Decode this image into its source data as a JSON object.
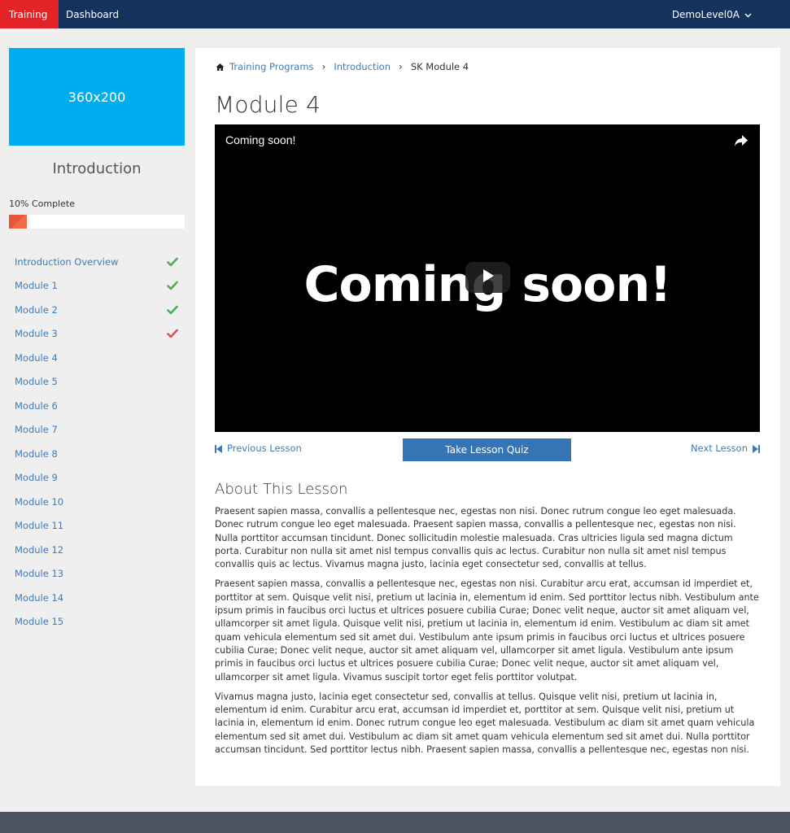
{
  "nav": {
    "tabs": [
      {
        "label": "Training",
        "active": true
      },
      {
        "label": "Dashboard",
        "active": false
      }
    ],
    "user": "DemoLevel0A"
  },
  "sidebar": {
    "thumbnail_text": "360x200",
    "course_title": "Introduction",
    "progress_label": "10% Complete",
    "progress_percent": 10,
    "modules": [
      {
        "label": "Introduction Overview",
        "status": "complete"
      },
      {
        "label": "Module 1",
        "status": "complete"
      },
      {
        "label": "Module 2",
        "status": "complete"
      },
      {
        "label": "Module 3",
        "status": "failed"
      },
      {
        "label": "Module 4",
        "status": "none"
      },
      {
        "label": "Module 5",
        "status": "none"
      },
      {
        "label": "Module 6",
        "status": "none"
      },
      {
        "label": "Module 7",
        "status": "none"
      },
      {
        "label": "Module 8",
        "status": "none"
      },
      {
        "label": "Module 9",
        "status": "none"
      },
      {
        "label": "Module 10",
        "status": "none"
      },
      {
        "label": "Module 11",
        "status": "none"
      },
      {
        "label": "Module 12",
        "status": "none"
      },
      {
        "label": "Module 13",
        "status": "none"
      },
      {
        "label": "Module 14",
        "status": "none"
      },
      {
        "label": "Module 15",
        "status": "none"
      }
    ]
  },
  "breadcrumb": {
    "items": [
      "Training Programs",
      "Introduction"
    ],
    "current": "SK Module 4"
  },
  "main": {
    "title": "Module 4",
    "video": {
      "title": "Coming soon!",
      "overlay_text": "Coming soon!"
    },
    "prev_label": "Previous Lesson",
    "quiz_label": "Take Lesson Quiz",
    "next_label": "Next Lesson",
    "about_heading": "About This Lesson",
    "about_paragraphs": [
      "Praesent sapien massa, convallis a pellentesque nec, egestas non nisi. Donec rutrum congue leo eget malesuada. Donec rutrum congue leo eget malesuada. Praesent sapien massa, convallis a pellentesque nec, egestas non nisi. Nulla porttitor accumsan tincidunt. Donec sollicitudin molestie malesuada. Cras ultricies ligula sed magna dictum porta. Curabitur non nulla sit amet nisl tempus convallis quis ac lectus. Curabitur non nulla sit amet nisl tempus convallis quis ac lectus. Vivamus magna justo, lacinia eget consectetur sed, convallis at tellus.",
      "Praesent sapien massa, convallis a pellentesque nec, egestas non nisi. Curabitur arcu erat, accumsan id imperdiet et, porttitor at sem. Quisque velit nisi, pretium ut lacinia in, elementum id enim. Sed porttitor lectus nibh. Vestibulum ante ipsum primis in faucibus orci luctus et ultrices posuere cubilia Curae; Donec velit neque, auctor sit amet aliquam vel, ullamcorper sit amet ligula. Quisque velit nisi, pretium ut lacinia in, elementum id enim. Vestibulum ac diam sit amet quam vehicula elementum sed sit amet dui. Vestibulum ante ipsum primis in faucibus orci luctus et ultrices posuere cubilia Curae; Donec velit neque, auctor sit amet aliquam vel, ullamcorper sit amet ligula. Vestibulum ante ipsum primis in faucibus orci luctus et ultrices posuere cubilia Curae; Donec velit neque, auctor sit amet aliquam vel, ullamcorper sit amet ligula. Vivamus suscipit tortor eget felis porttitor volutpat.",
      "Vivamus magna justo, lacinia eget consectetur sed, convallis at tellus. Quisque velit nisi, pretium ut lacinia in, elementum id enim. Curabitur arcu erat, accumsan id imperdiet et, porttitor at sem. Quisque velit nisi, pretium ut lacinia in, elementum id enim. Donec rutrum congue leo eget malesuada. Vestibulum ac diam sit amet quam vehicula elementum sed sit amet dui. Vestibulum ac diam sit amet quam vehicula elementum sed sit amet dui. Nulla porttitor accumsan tincidunt. Sed porttitor lectus nibh. Praesent sapien massa, convallis a pellentesque nec, egestas non nisi."
    ]
  },
  "colors": {
    "nav_bg": "#14325b",
    "active_tab": "#e22427",
    "thumbnail": "#00aeef",
    "link": "#3f7ab8",
    "check_complete": "#4caf50",
    "check_failed": "#d9534f",
    "quiz_button": "#3575b5",
    "footer": "#4a5561"
  },
  "icons": {
    "home": "home-icon",
    "share": "share-icon",
    "play": "play-icon",
    "prev": "skip-back-icon",
    "next": "skip-forward-icon",
    "user_menu": "chevron-down-icon",
    "check": "check-icon"
  }
}
